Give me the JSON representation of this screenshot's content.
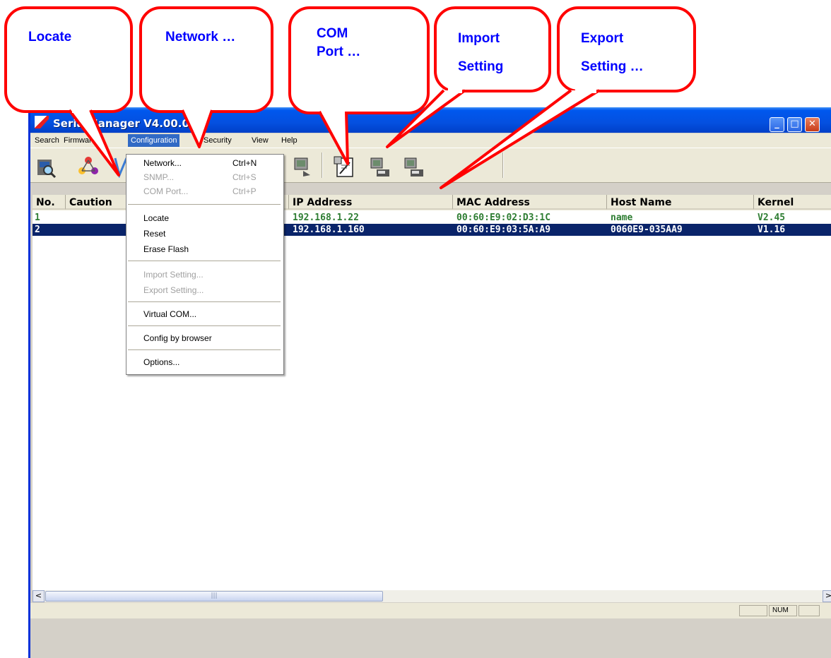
{
  "callouts": {
    "locate": "Locate",
    "network": "Network …",
    "com_port": "COM\nPort …",
    "import": "Import\nSetting",
    "export": "Export\nSetting …"
  },
  "window": {
    "title": "SerialManager V4.00.0",
    "controls": [
      "minimize",
      "maximize",
      "close"
    ]
  },
  "menubar": [
    "Search",
    "Firmware",
    "Configuration",
    "Security",
    "View",
    "Help"
  ],
  "dropdown": {
    "groups": [
      [
        {
          "label": "Network...",
          "shortcut": "Ctrl+N",
          "enabled": true
        },
        {
          "label": "SNMP...",
          "shortcut": "Ctrl+S",
          "enabled": false
        },
        {
          "label": "COM Port...",
          "shortcut": "Ctrl+P",
          "enabled": false
        }
      ],
      [
        {
          "label": "Locate",
          "enabled": true
        },
        {
          "label": "Reset",
          "enabled": true
        },
        {
          "label": "Erase Flash",
          "enabled": true
        }
      ],
      [
        {
          "label": "Import Setting...",
          "enabled": false
        },
        {
          "label": "Export Setting...",
          "enabled": false
        }
      ],
      [
        {
          "label": "Virtual COM...",
          "enabled": true
        }
      ],
      [
        {
          "label": "Config by browser",
          "enabled": true
        }
      ],
      [
        {
          "label": "Options...",
          "enabled": true
        }
      ]
    ]
  },
  "toolbar_icons": [
    "search-device-icon",
    "network-icon",
    "locate-icon",
    "com-device-icon",
    "com-port-icon",
    "import-setting-icon",
    "export-setting-icon"
  ],
  "table": {
    "columns": [
      "No.",
      "Caution",
      "IP Address",
      "MAC Address",
      "Host Name",
      "Kernel"
    ],
    "rows": [
      {
        "no": "1",
        "caution": "",
        "ip": "192.168.1.22",
        "mac": "00:60:E9:02:D3:1C",
        "host": "name",
        "kernel": "V2.45",
        "selected": false
      },
      {
        "no": "2",
        "caution": "",
        "ip": "192.168.1.160",
        "mac": "00:60:E9:03:5A:A9",
        "host": "0060E9-035AA9",
        "kernel": "V1.16",
        "selected": true
      }
    ]
  },
  "statusbar": {
    "num": "NUM"
  },
  "colors": {
    "callout_border": "#ff0000",
    "callout_text": "#0000ff",
    "selection": "#0a246a",
    "row_text": "#2e7d32"
  }
}
